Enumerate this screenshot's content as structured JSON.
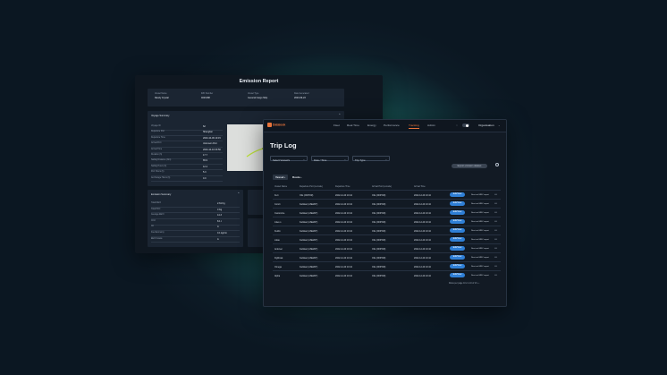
{
  "emission": {
    "title": "Emission Report",
    "header_fields": [
      {
        "label": "Vessel Name",
        "value": "Randy Crystal"
      },
      {
        "label": "IMO Number",
        "value": "4023188"
      },
      {
        "label": "Vessel Type",
        "value": "General Cargo Ship"
      },
      {
        "label": "Date Generated",
        "value": "2023-09-23"
      }
    ],
    "voyage_title": "Voyage Summary",
    "voyage_rows": [
      {
        "label": "Voyage ID",
        "value": "62"
      },
      {
        "label": "Departure Port",
        "value": "Shanghai"
      },
      {
        "label": "Departure Time",
        "value": "2023-10-09 10:15"
      },
      {
        "label": "Arrival Port",
        "value": "Unknown Port"
      },
      {
        "label": "Arrival Time",
        "value": "2023-10-10 03:50"
      },
      {
        "label": "Duration (h)",
        "value": "17.7"
      },
      {
        "label": "Sailing Distance (Nm)",
        "value": "65.9"
      },
      {
        "label": "Sailing Hours (h)",
        "value": "12.4"
      },
      {
        "label": "Port Hours (h)",
        "value": "5.3"
      },
      {
        "label": "Anchorage Hours (h)",
        "value": "0.0"
      }
    ],
    "summary_title": "Emission Summary",
    "summary_rows": [
      {
        "label": "Total MGO",
        "value": "2.61 Kg"
      },
      {
        "label": "Total HFO",
        "value": "0 Kg"
      },
      {
        "label": "Average EEXI",
        "value": "14.3"
      },
      {
        "label": "CO2",
        "value": "8.1 t"
      },
      {
        "label": "CII",
        "value": "C"
      },
      {
        "label": "Fuel Economy",
        "value": "0.1 kg/nm"
      },
      {
        "label": "EEOI Grade",
        "value": "A"
      }
    ]
  },
  "triplog": {
    "logo": "Datalook",
    "nav": [
      "Fleet",
      "Real Time",
      "Energy",
      "Performance",
      "Tracking",
      "Admin"
    ],
    "active_nav": "Tracking",
    "org": "Organisation",
    "title": "Trip Log",
    "filters": [
      "Select Vessel/s",
      "Date / Time",
      "Trip Type"
    ],
    "export_label": "Export emission dataset",
    "tabs": [
      "Vessel",
      "Route"
    ],
    "columns": [
      "Vessel Name",
      "Departure Port (Locode)",
      "Departure Time",
      "Arrival Port (Locode)",
      "Arrival Time"
    ],
    "rows": [
      {
        "vessel": "Kurt",
        "dep_port": "Olio (NOPOR)",
        "dep_time": "2022-12-20 10:44",
        "arr_port": "Olio (NOPOR)",
        "arr_time": "2022-12-20 10:44"
      },
      {
        "vessel": "Conrit",
        "dep_port": "Karlskar (ASE2DT)",
        "dep_time": "2022-12-20 10:44",
        "arr_port": "Olio (NOPOR)",
        "arr_time": "2022-12-20 10:44"
      },
      {
        "vessel": "Customize",
        "dep_port": "Karlskar (ASE2DT)",
        "dep_time": "2022-12-20 10:44",
        "arr_port": "Olio (NOPOR)",
        "arr_time": "2022-12-20 10:44"
      },
      {
        "vessel": "Jules s",
        "dep_port": "Karlskar (ASE2DT)",
        "dep_time": "2022-12-20 10:44",
        "arr_port": "Olio (NOPOR)",
        "arr_time": "2022-12-20 10:44"
      },
      {
        "vessel": "Kuldin",
        "dep_port": "Karlskar (ASE2DT)",
        "dep_time": "2022-12-20 10:44",
        "arr_port": "Olio (NOPOR)",
        "arr_time": "2022-12-20 10:44"
      },
      {
        "vessel": "Lidas",
        "dep_port": "Karlskar (ASE2DT)",
        "dep_time": "2022-12-20 10:44",
        "arr_port": "Olio (NOPOR)",
        "arr_time": "2022-12-20 10:44"
      },
      {
        "vessel": "Andover",
        "dep_port": "Karlskar (ASE2DT)",
        "dep_time": "2022-12-20 10:44",
        "arr_port": "Olio (NOPOR)",
        "arr_time": "2022-12-20 10:44"
      },
      {
        "vessel": "Fighboat",
        "dep_port": "Karlskar (ASE2DT)",
        "dep_time": "2022-12-20 10:44",
        "arr_port": "Olio (NOPOR)",
        "arr_time": "2022-12-20 10:44"
      },
      {
        "vessel": "Omega",
        "dep_port": "Karlskar (ASE2DT)",
        "dep_time": "2022-12-20 10:44",
        "arr_port": "Olio (NOPOR)",
        "arr_time": "2022-12-20 10:44"
      },
      {
        "vessel": "Alpha",
        "dep_port": "Karlskar (ASE2DT)",
        "dep_time": "2022-12-20 10:44",
        "arr_port": "Olio (NOPOR)",
        "arr_time": "2022-12-20 10:44"
      }
    ],
    "row_button": "Edit/View",
    "row_link": "Next set MRV report",
    "row_menu": "•••",
    "pager": "Rows per page  10  ▾     1-10 of 13     ‹  ›"
  }
}
